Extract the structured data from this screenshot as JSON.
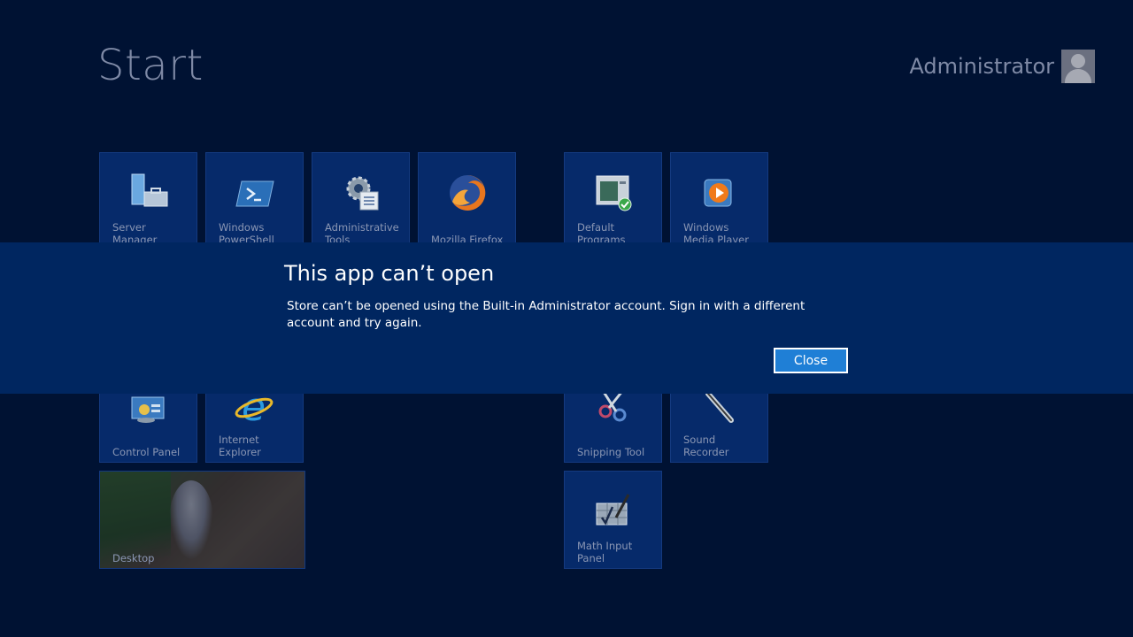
{
  "header": {
    "title": "Start",
    "user_name": "Administrator"
  },
  "tiles": {
    "server_manager": "Server Manager",
    "powershell": "Windows PowerShell",
    "admin_tools": "Administrative Tools",
    "firefox": "Mozilla Firefox",
    "control_panel": "Control Panel",
    "ie": "Internet Explorer",
    "desktop": "Desktop",
    "default_programs": "Default Programs",
    "wmp": "Windows Media Player",
    "snipping": "Snipping Tool",
    "sound_recorder": "Sound Recorder",
    "math_input": "Math Input Panel"
  },
  "dialog": {
    "title": "This app can’t open",
    "message": "Store can’t be opened using the Built-in Administrator account. Sign in with a different account and try again.",
    "close_label": "Close"
  },
  "colors": {
    "background": "#001233",
    "tile": "#062a6a",
    "dialog": "#002660",
    "accent_button": "#1f7fd6"
  }
}
